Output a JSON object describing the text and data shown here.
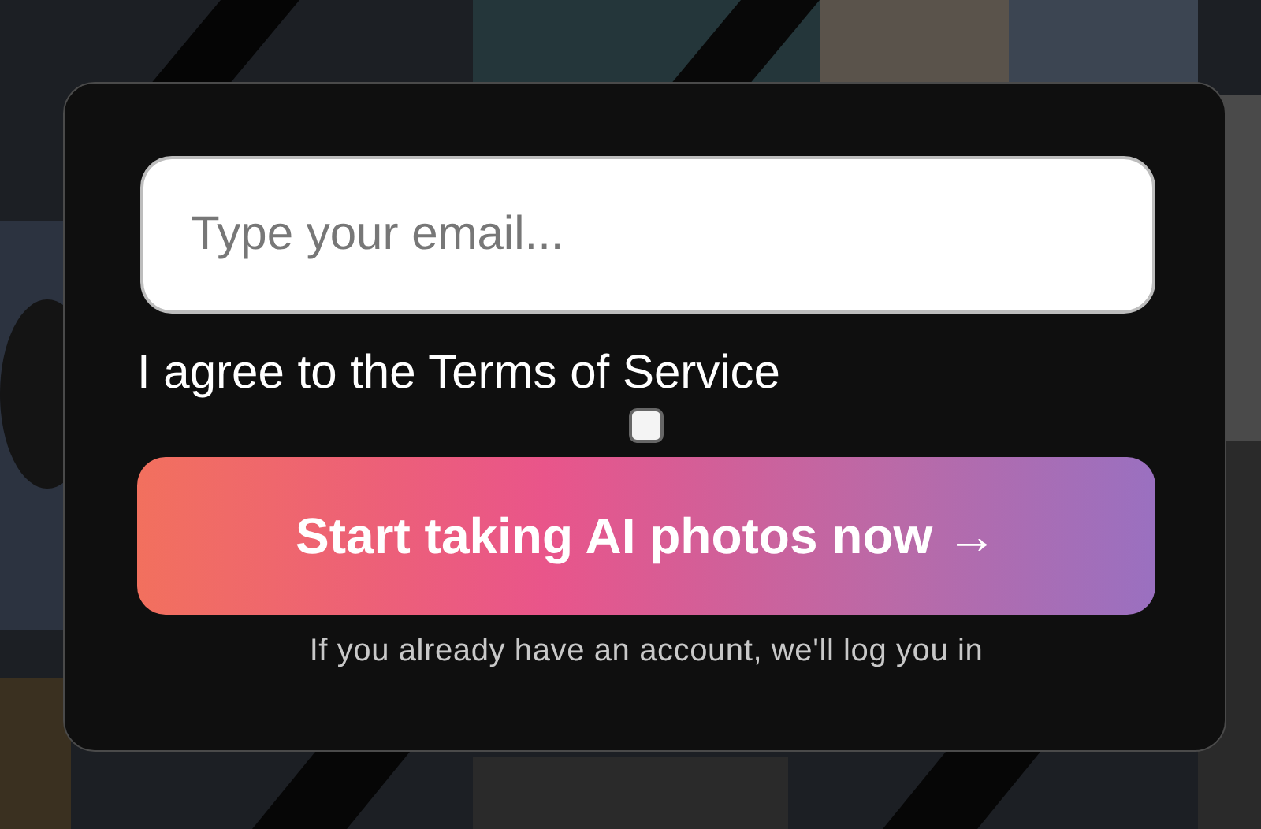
{
  "email_field": {
    "placeholder": "Type your email..."
  },
  "terms": {
    "label": "I agree to the Terms of Service",
    "checked": false
  },
  "submit_button": {
    "label": "Start taking AI photos now →"
  },
  "note": "If you already have an account, we'll log you in"
}
